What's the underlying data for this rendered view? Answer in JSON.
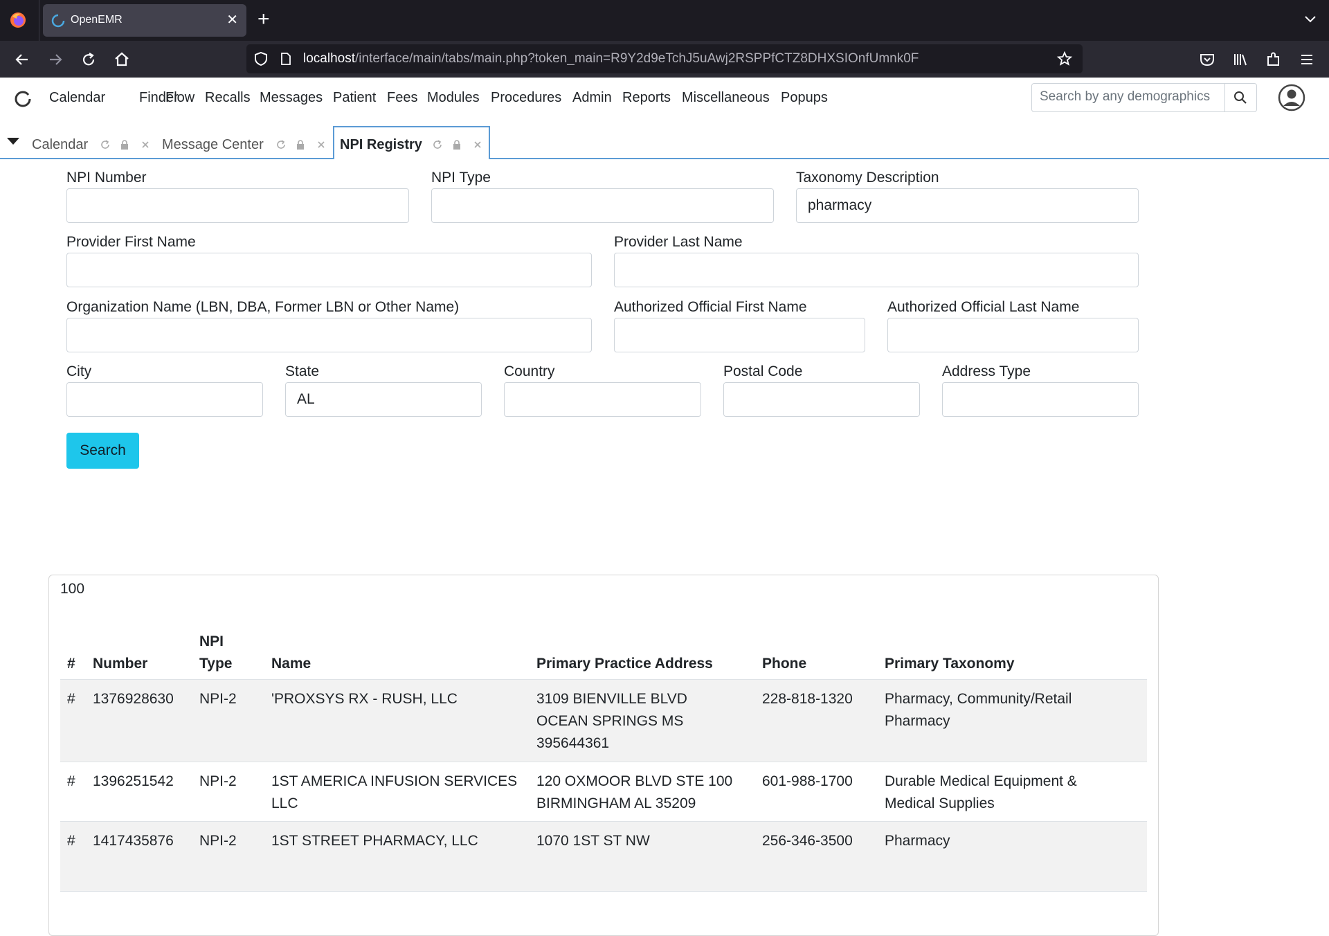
{
  "browser": {
    "tab_title": "OpenEMR",
    "url_host": "localhost",
    "url_path": "/interface/main/tabs/main.php?token_main=R9Y2d9eTchJ5uAwj2RSPPfCTZ8DHXSIOnfUmnk0F"
  },
  "menu": {
    "items": [
      "Calendar",
      "Finder",
      "Flow",
      "Recalls",
      "Messages",
      "Patient",
      "Fees",
      "Modules",
      "Procedures",
      "Admin",
      "Reports",
      "Miscellaneous",
      "Popups"
    ],
    "search_placeholder": "Search by any demographics"
  },
  "tabs": [
    {
      "label": "Calendar",
      "active": false
    },
    {
      "label": "Message Center",
      "active": false
    },
    {
      "label": "NPI Registry",
      "active": true
    }
  ],
  "form": {
    "npi_number": {
      "label": "NPI Number",
      "value": ""
    },
    "npi_type": {
      "label": "NPI Type",
      "value": ""
    },
    "taxonomy": {
      "label": "Taxonomy Description",
      "value": "pharmacy"
    },
    "provider_first": {
      "label": "Provider First Name",
      "value": ""
    },
    "provider_last": {
      "label": "Provider Last Name",
      "value": ""
    },
    "org_name": {
      "label": "Organization Name (LBN, DBA, Former LBN or Other Name)",
      "value": ""
    },
    "auth_first": {
      "label": "Authorized Official First Name",
      "value": ""
    },
    "auth_last": {
      "label": "Authorized Official Last Name",
      "value": ""
    },
    "city": {
      "label": "City",
      "value": ""
    },
    "state": {
      "label": "State",
      "value": "AL"
    },
    "country": {
      "label": "Country",
      "value": ""
    },
    "postal": {
      "label": "Postal Code",
      "value": ""
    },
    "address_type": {
      "label": "Address Type",
      "value": ""
    },
    "search_button": "Search"
  },
  "results": {
    "count": "100",
    "headers": {
      "hash": "#",
      "number": "Number",
      "npi_type_1": "NPI",
      "npi_type_2": "Type",
      "name": "Name",
      "address": "Primary Practice Address",
      "phone": "Phone",
      "taxonomy": "Primary Taxonomy"
    },
    "rows": [
      {
        "hash": "#",
        "number": "1376928630",
        "type": "NPI-2",
        "name_1": "'PROXSYS RX - RUSH, LLC",
        "name_2": "",
        "addr_1": "3109 BIENVILLE BLVD",
        "addr_2": "OCEAN SPRINGS MS",
        "addr_3": "395644361",
        "phone": "228-818-1320",
        "tax_1": "Pharmacy, Community/Retail",
        "tax_2": "Pharmacy"
      },
      {
        "hash": "#",
        "number": "1396251542",
        "type": "NPI-2",
        "name_1": "1ST AMERICA INFUSION SERVICES",
        "name_2": "LLC",
        "addr_1": "120 OXMOOR BLVD STE 100",
        "addr_2": "BIRMINGHAM AL 35209",
        "addr_3": "",
        "phone": "601-988-1700",
        "tax_1": "Durable Medical Equipment &",
        "tax_2": "Medical Supplies"
      },
      {
        "hash": "#",
        "number": "1417435876",
        "type": "NPI-2",
        "name_1": "1ST STREET PHARMACY, LLC",
        "name_2": "",
        "addr_1": "1070 1ST ST NW",
        "addr_2": "",
        "addr_3": "",
        "phone": "256-346-3500",
        "tax_1": "Pharmacy",
        "tax_2": ""
      }
    ]
  }
}
